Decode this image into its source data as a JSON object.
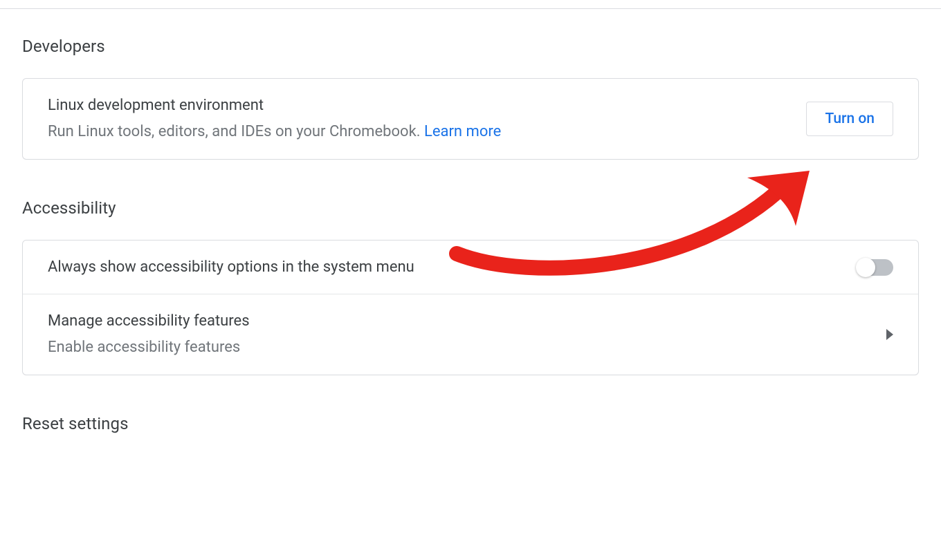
{
  "sections": {
    "developers": {
      "heading": "Developers",
      "linux": {
        "title": "Linux development environment",
        "subtitle_prefix": "Run Linux tools, editors, and IDEs on your Chromebook. ",
        "learn_more": "Learn more",
        "button": "Turn on"
      }
    },
    "accessibility": {
      "heading": "Accessibility",
      "always_show": {
        "title": "Always show accessibility options in the system menu"
      },
      "manage": {
        "title": "Manage accessibility features",
        "subtitle": "Enable accessibility features"
      }
    },
    "reset": {
      "heading": "Reset settings"
    }
  }
}
